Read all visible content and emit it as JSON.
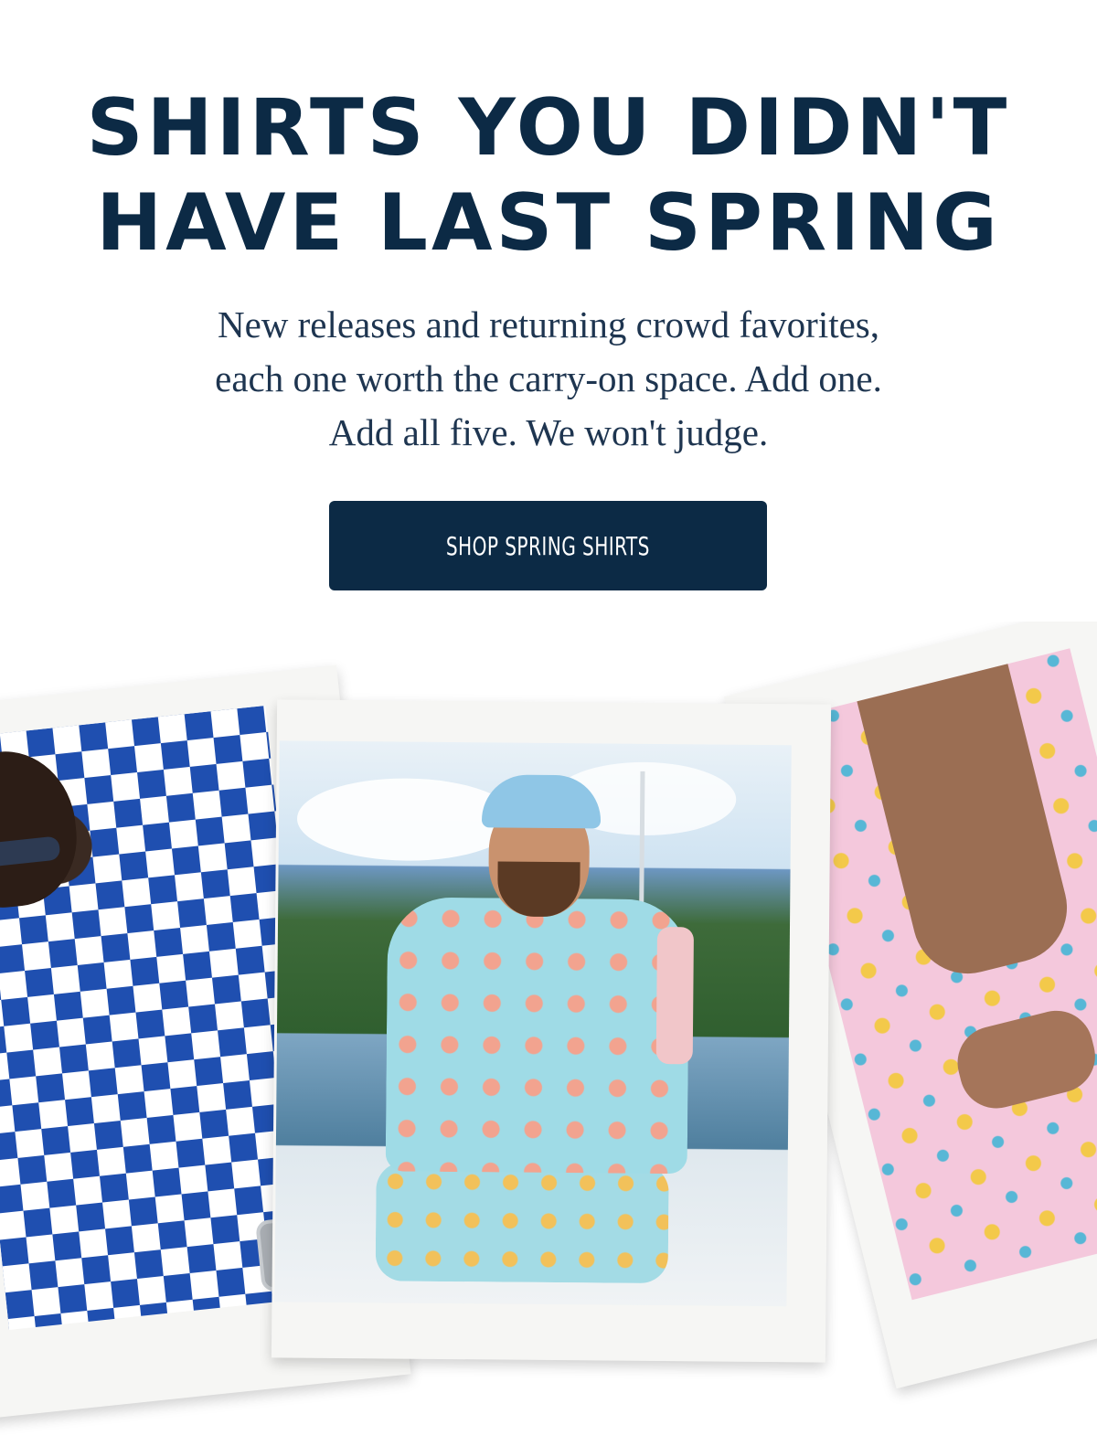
{
  "hero": {
    "headline_line1": "SHIRTS YOU DIDN'T",
    "headline_line2": "HAVE LAST SPRING",
    "subcopy_line1": "New releases and returning crowd favorites,",
    "subcopy_line2": "each one worth the carry-on space. Add one.",
    "subcopy_line3": "Add all five. We won't judge.",
    "cta_label": "SHOP SPRING SHIRTS"
  },
  "colors": {
    "navy": "#0c2a45",
    "background": "#ffffff",
    "polaroid_frame": "#f6f6f4"
  },
  "collage": {
    "photos": [
      {
        "name": "blue-geometric-shirt-photo"
      },
      {
        "name": "aqua-floral-shirt-boat-photo"
      },
      {
        "name": "pink-tropical-shirt-photo"
      }
    ]
  }
}
